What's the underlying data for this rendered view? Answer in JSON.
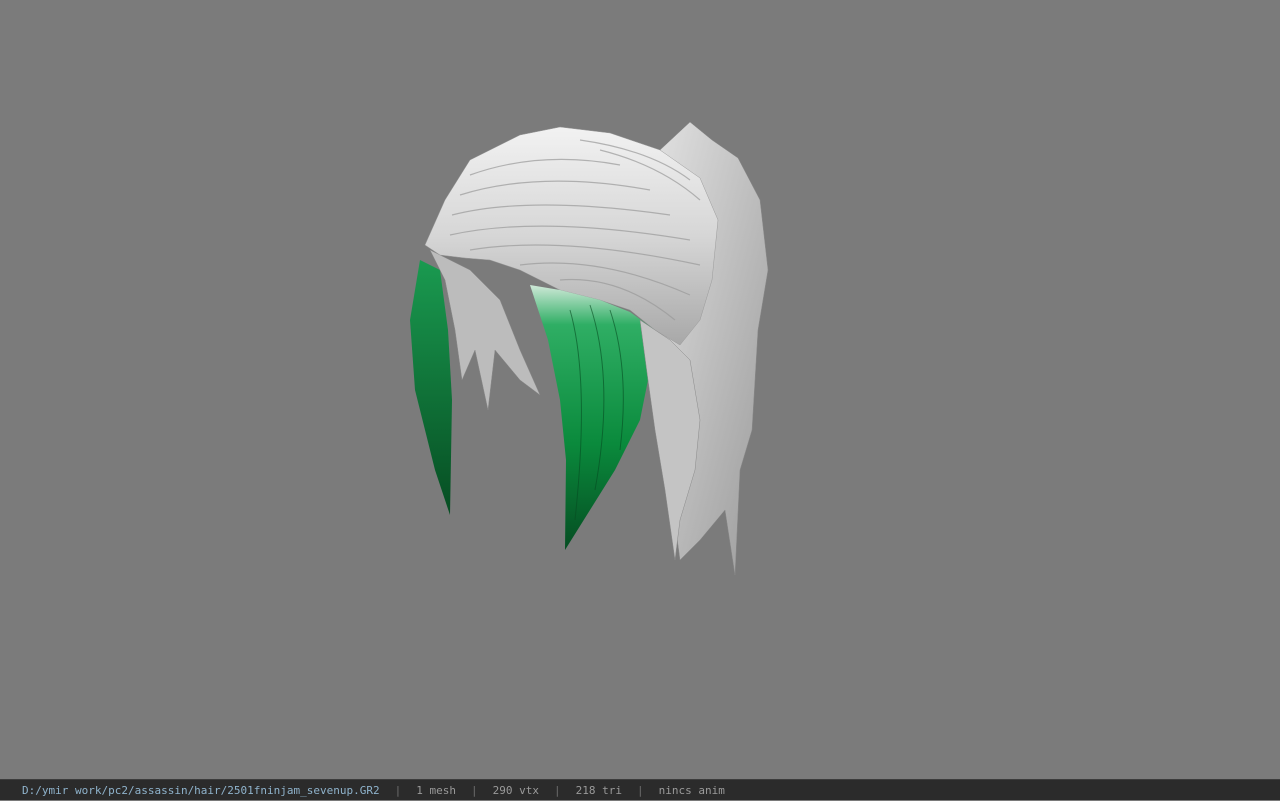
{
  "viewer": {
    "model_name": "hair model",
    "colors": {
      "background": "#7b7b7b",
      "hair_silver": "#d9d9d9",
      "hair_shadow": "#9c9c9c",
      "hair_green": "#0b8a3c",
      "status_bg": "#2b2b2b",
      "path_text": "#8fb3cc",
      "stat_text": "#9a9a9a"
    }
  },
  "status_bar": {
    "file_path": "D:/ymir work/pc2/assassin/hair/2501fninjam_sevenup.GR2",
    "separator": "|",
    "mesh_count": "1 mesh",
    "vertex_count": "290 vtx",
    "triangle_count": "218 tri",
    "anim_status": "nincs anim"
  }
}
